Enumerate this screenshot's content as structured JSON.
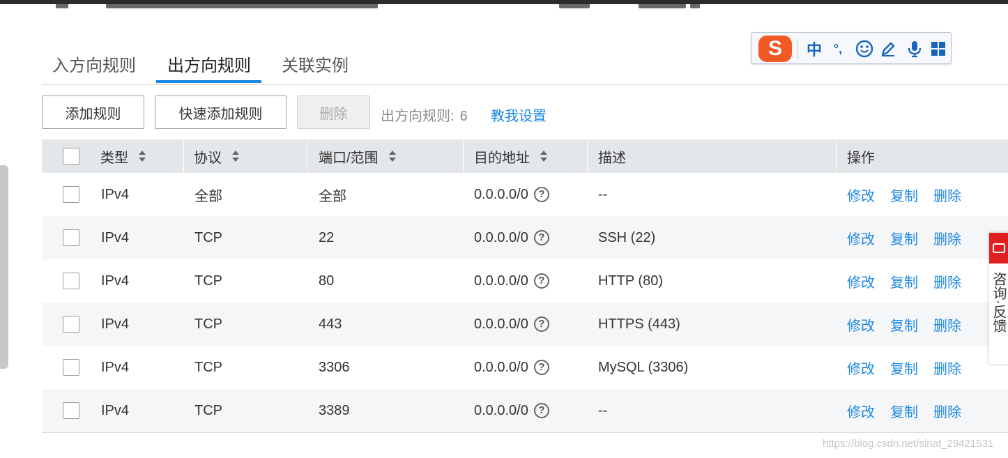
{
  "tabs": [
    {
      "label": "入方向规则"
    },
    {
      "label": "出方向规则"
    },
    {
      "label": "关联实例"
    }
  ],
  "active_tab": "出方向规则",
  "ime_toolbar": {
    "logo": "S",
    "mode": "中",
    "punct": "°,",
    "items": [
      "smiley-icon",
      "pen-icon",
      "microphone-icon",
      "grid-icon"
    ]
  },
  "toolbar": {
    "add_rule": "添加规则",
    "quick_add_rule": "快速添加规则",
    "delete": "删除",
    "rule_count_label": "出方向规则:",
    "rule_count": "6",
    "help_link": "教我设置"
  },
  "table": {
    "headers": {
      "type": "类型",
      "protocol": "协议",
      "port_range": "端口/范围",
      "destination": "目的地址",
      "description": "描述",
      "actions": "操作"
    },
    "rows": [
      {
        "type": "IPv4",
        "protocol": "全部",
        "port": "全部",
        "destination": "0.0.0.0/0",
        "description": "--"
      },
      {
        "type": "IPv4",
        "protocol": "TCP",
        "port": "22",
        "destination": "0.0.0.0/0",
        "description": "SSH (22)"
      },
      {
        "type": "IPv4",
        "protocol": "TCP",
        "port": "80",
        "destination": "0.0.0.0/0",
        "description": "HTTP (80)"
      },
      {
        "type": "IPv4",
        "protocol": "TCP",
        "port": "443",
        "destination": "0.0.0.0/0",
        "description": "HTTPS (443)"
      },
      {
        "type": "IPv4",
        "protocol": "TCP",
        "port": "3306",
        "destination": "0.0.0.0/0",
        "description": "MySQL (3306)"
      },
      {
        "type": "IPv4",
        "protocol": "TCP",
        "port": "3389",
        "destination": "0.0.0.0/0",
        "description": "--"
      }
    ],
    "actions": {
      "edit": "修改",
      "copy": "复制",
      "delete": "删除"
    },
    "help_icon_glyph": "?"
  },
  "feedback_widget": {
    "label": "咨询·反馈"
  },
  "watermark": "https://blog.csdn.net/sinat_29421531",
  "colors": {
    "accent": "#1e88e5",
    "header_bg": "#e4e7ea",
    "feedback_red": "#e02020",
    "ime_orange": "#f15a24"
  }
}
